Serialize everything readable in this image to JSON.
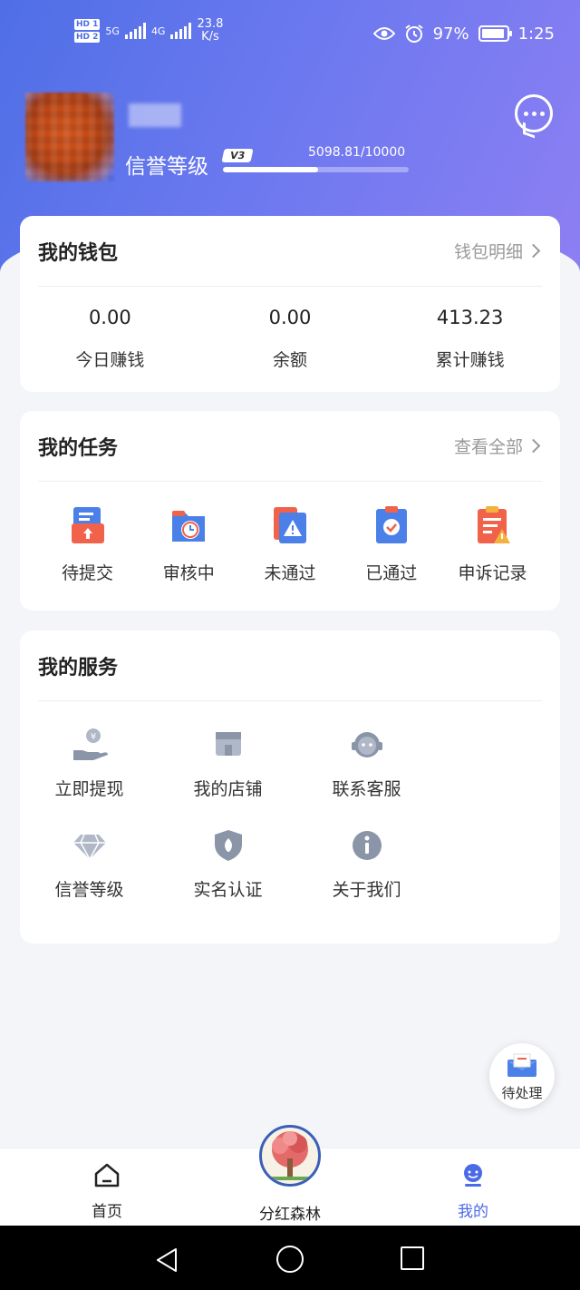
{
  "status_bar": {
    "hd1": "HD 1",
    "hd2": "HD 2",
    "net1": "5G",
    "net2": "4G",
    "speed": "23.8",
    "speed_unit": "K/s",
    "battery": "97%",
    "battery_level": 0.97,
    "time": "1:25"
  },
  "profile": {
    "level_title": "信誉等级",
    "level_badge": "V3",
    "progress_text": "5098.81/10000",
    "progress_fraction": 0.51
  },
  "wallet": {
    "title": "我的钱包",
    "link": "钱包明细",
    "items": [
      {
        "value": "0.00",
        "label": "今日赚钱"
      },
      {
        "value": "0.00",
        "label": "余额"
      },
      {
        "value": "413.23",
        "label": "累计赚钱"
      }
    ]
  },
  "tasks": {
    "title": "我的任务",
    "link": "查看全部",
    "items": [
      {
        "label": "待提交",
        "icon": "upload-folder-icon"
      },
      {
        "label": "审核中",
        "icon": "clock-folder-icon"
      },
      {
        "label": "未通过",
        "icon": "warning-folder-icon"
      },
      {
        "label": "已通过",
        "icon": "check-clipboard-icon"
      },
      {
        "label": "申诉记录",
        "icon": "appeal-record-icon"
      }
    ]
  },
  "services": {
    "title": "我的服务",
    "items": [
      {
        "label": "立即提现",
        "icon": "withdraw-icon"
      },
      {
        "label": "我的店铺",
        "icon": "store-icon"
      },
      {
        "label": "联系客服",
        "icon": "customer-service-icon"
      },
      {
        "label": "信誉等级",
        "icon": "diamond-icon"
      },
      {
        "label": "实名认证",
        "icon": "shield-icon"
      },
      {
        "label": "关于我们",
        "icon": "info-icon"
      }
    ]
  },
  "floating": {
    "pending_label": "待处理"
  },
  "tabbar": {
    "home": "首页",
    "forest": "分红森林",
    "mine": "我的"
  },
  "colors": {
    "accent": "#4a6ae8",
    "gradient_start": "#4f6fe6",
    "gradient_end": "#8d7ff3"
  }
}
